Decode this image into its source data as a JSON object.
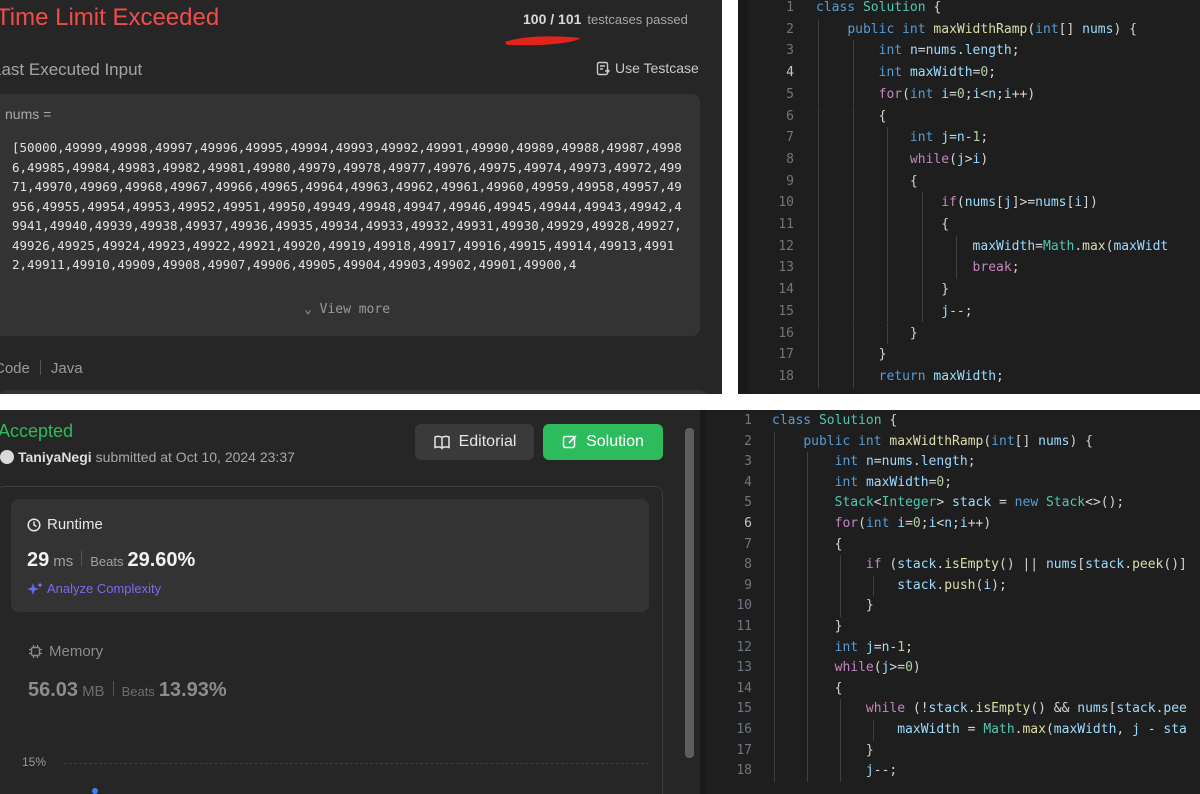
{
  "tle": {
    "title": "Time Limit Exceeded",
    "testcases_count": "100 / 101",
    "testcases_label": "testcases passed",
    "last_input_label": "Last Executed Input",
    "use_testcase": "Use Testcase",
    "nums_label": "nums =",
    "nums_value": "[50000,49999,49998,49997,49996,49995,49994,49993,49992,49991,49990,49989,49988,49987,49986,49985,49984,49983,49982,49981,49980,49979,49978,49977,49976,49975,49974,49973,49972,49971,49970,49969,49968,49967,49966,49965,49964,49963,49962,49961,49960,49959,49958,49957,49956,49955,49954,49953,49952,49951,49950,49949,49948,49947,49946,49945,49944,49943,49942,49941,49940,49939,49938,49937,49936,49935,49934,49933,49932,49931,49930,49929,49928,49927,49926,49925,49924,49923,49922,49921,49920,49919,49918,49917,49916,49915,49914,49913,49912,49911,49910,49909,49908,49907,49906,49905,49904,49903,49902,49901,49900,4",
    "view_more": "View more",
    "code_label": "Code",
    "lang_label": "Java",
    "accent": "#f14c4c"
  },
  "accepted": {
    "title": "Accepted",
    "username": "TaniyaNegi",
    "submitted_text": "submitted at Oct 10, 2024 23:37",
    "editorial_button": "Editorial",
    "solution_button": "Solution",
    "runtime_label": "Runtime",
    "runtime_value": "29",
    "runtime_unit": "ms",
    "beats_label": "Beats",
    "runtime_beats": "29.60%",
    "analyze_label": "Analyze Complexity",
    "memory_label": "Memory",
    "memory_value": "56.03",
    "memory_unit": "MB",
    "memory_beats": "13.93%",
    "chart_tick": "15%",
    "accent": "#2cbb5d"
  },
  "top_code": [
    {
      "n": "1",
      "t": "class Solution {"
    },
    {
      "n": "2",
      "t": "    public int maxWidthRamp(int[] nums) {"
    },
    {
      "n": "3",
      "t": "        int n=nums.length;"
    },
    {
      "n": "4",
      "t": "        int maxWidth=0;"
    },
    {
      "n": "5",
      "t": "        for(int i=0;i<n;i++)"
    },
    {
      "n": "6",
      "t": "        {"
    },
    {
      "n": "7",
      "t": "            int j=n-1;"
    },
    {
      "n": "8",
      "t": "            while(j>i)"
    },
    {
      "n": "9",
      "t": "            {"
    },
    {
      "n": "10",
      "t": "                if(nums[j]>=nums[i])"
    },
    {
      "n": "11",
      "t": "                {"
    },
    {
      "n": "12",
      "t": "                    maxWidth=Math.max(maxWidt"
    },
    {
      "n": "13",
      "t": "                    break;"
    },
    {
      "n": "14",
      "t": "                }"
    },
    {
      "n": "15",
      "t": "                j--;"
    },
    {
      "n": "16",
      "t": "            }"
    },
    {
      "n": "17",
      "t": "        }"
    },
    {
      "n": "18",
      "t": "        return maxWidth;"
    }
  ],
  "bottom_code": [
    {
      "n": "1",
      "t": "class Solution {"
    },
    {
      "n": "2",
      "t": "    public int maxWidthRamp(int[] nums) {"
    },
    {
      "n": "3",
      "t": "        int n=nums.length;"
    },
    {
      "n": "4",
      "t": "        int maxWidth=0;"
    },
    {
      "n": "5",
      "t": "        Stack<Integer> stack = new Stack<>();"
    },
    {
      "n": "6",
      "t": "        for(int i=0;i<n;i++)"
    },
    {
      "n": "7",
      "t": "        {"
    },
    {
      "n": "8",
      "t": "            if (stack.isEmpty() || nums[stack.peek()]"
    },
    {
      "n": "9",
      "t": "                stack.push(i);"
    },
    {
      "n": "10",
      "t": "            }"
    },
    {
      "n": "11",
      "t": "        }"
    },
    {
      "n": "12",
      "t": "        int j=n-1;"
    },
    {
      "n": "13",
      "t": "        while(j>=0)"
    },
    {
      "n": "14",
      "t": "        {"
    },
    {
      "n": "15",
      "t": "            while (!stack.isEmpty() && nums[stack.pee"
    },
    {
      "n": "16",
      "t": "                maxWidth = Math.max(maxWidth, j - sta"
    },
    {
      "n": "17",
      "t": "            }"
    },
    {
      "n": "18",
      "t": "            j--;"
    }
  ]
}
